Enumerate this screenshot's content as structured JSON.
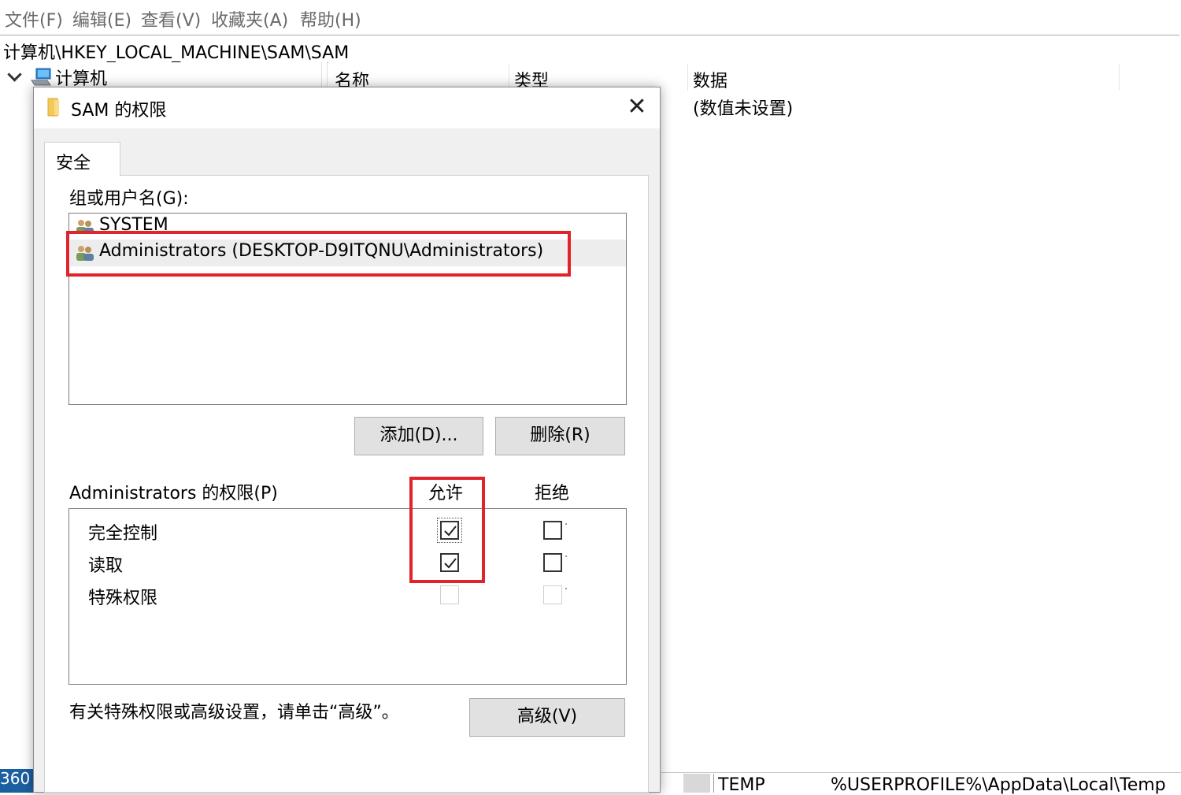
{
  "menu": [
    "文件(F)",
    "编辑(E)",
    "查看(V)",
    "收藏夹(A)",
    "帮助(H)"
  ],
  "address_path": "计算机\\HKEY_LOCAL_MACHINE\\SAM\\SAM",
  "tree": {
    "root_label": "计算机"
  },
  "values_pane": {
    "columns": [
      "名称",
      "类型",
      "数据"
    ],
    "data_value": "(数值未设置)"
  },
  "bottom_fragments": {
    "left_text": "360",
    "row_name": "TEMP",
    "row_data": "%USERPROFILE%\\AppData\\Local\\Temp"
  },
  "dialog": {
    "title": "SAM 的权限",
    "tab_label": "安全",
    "groups_label": "组或用户名(G):",
    "users": [
      {
        "name": "SYSTEM",
        "selected": false
      },
      {
        "name": "Administrators (DESKTOP-D9ITQNU\\Administrators)",
        "selected": true
      }
    ],
    "add_button": "添加(D)...",
    "remove_button": "删除(R)",
    "permissions_label": "Administrators 的权限(P)",
    "allow_header": "允许",
    "deny_header": "拒绝",
    "permissions": [
      {
        "name": "完全控制",
        "allow": true,
        "deny": false,
        "enabled": true
      },
      {
        "name": "读取",
        "allow": true,
        "deny": false,
        "enabled": true
      },
      {
        "name": "特殊权限",
        "allow": false,
        "deny": false,
        "enabled": false
      }
    ],
    "advanced_hint": "有关特殊权限或高级设置，请单击“高级”。",
    "advanced_button": "高级(V)"
  },
  "colors": {
    "highlight": "#e0242b",
    "dialog_bg": "#f0f0f0",
    "button_bg": "#e1e1e1"
  }
}
